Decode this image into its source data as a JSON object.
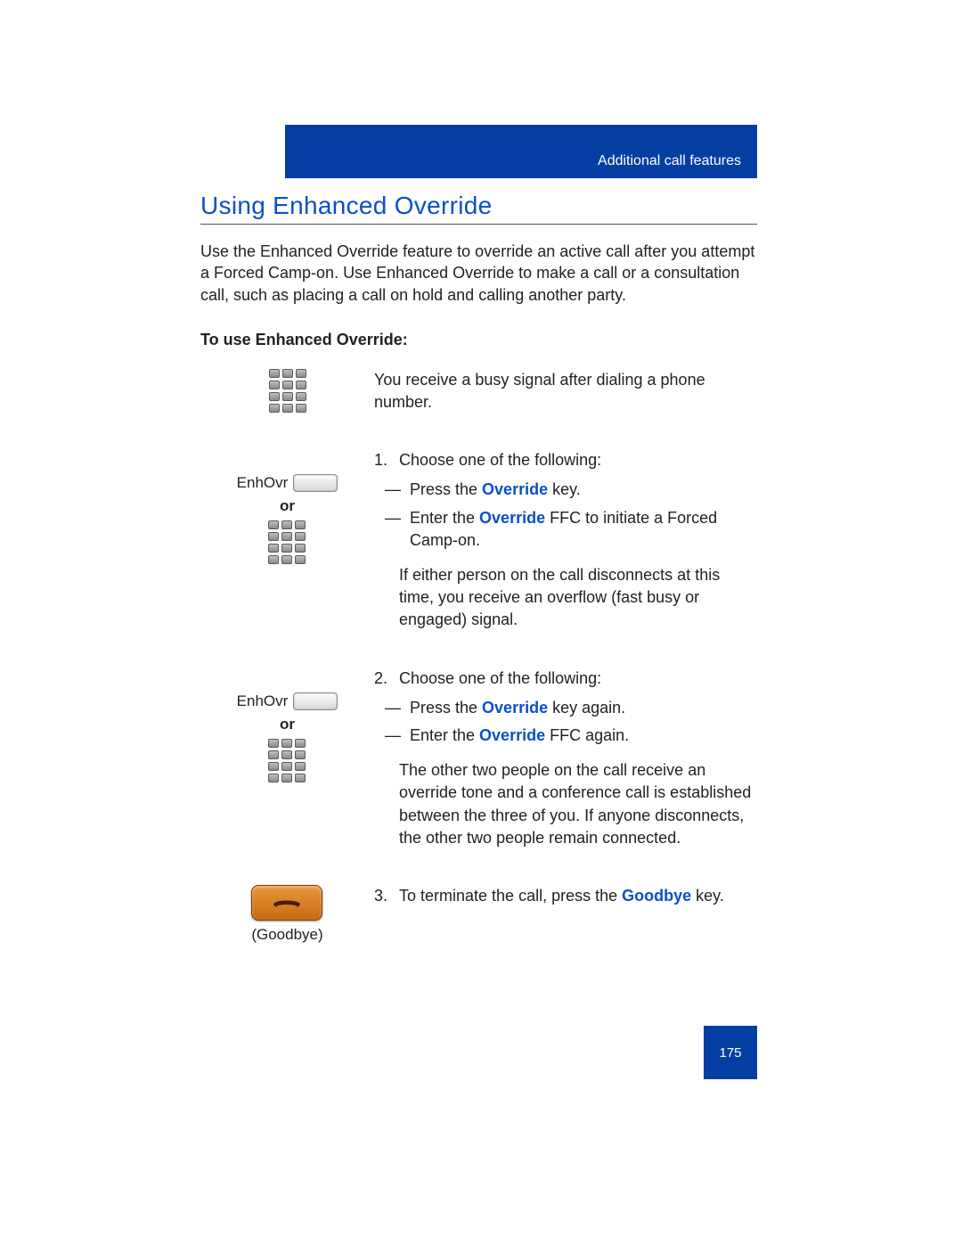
{
  "header": {
    "category": "Additional call features"
  },
  "title": "Using Enhanced Override",
  "intro": "Use the Enhanced Override feature to override an active call after you attempt a Forced Camp-on. Use Enhanced Override to make a call or a consultation call, such as placing a call on hold and calling another party.",
  "subhead": "To use Enhanced Override:",
  "labels": {
    "enhovr": "EnhOvr",
    "or": "or",
    "goodbye": "(Goodbye)"
  },
  "step0": "You receive a busy signal after dialing a phone number.",
  "step1": {
    "num": "1.",
    "lead": "Choose one of the following:",
    "a_pre": "Press the ",
    "a_key": "Override",
    "a_post": " key.",
    "b_pre": "Enter the ",
    "b_key": "Override",
    "b_post": " FFC to initiate a Forced Camp-on.",
    "note": "If either person on the call disconnects at this time, you receive an overflow (fast busy or engaged) signal."
  },
  "step2": {
    "num": "2.",
    "lead": "Choose one of the following:",
    "a_pre": "Press the ",
    "a_key": "Override",
    "a_post": " key again.",
    "b_pre": "Enter the ",
    "b_key": "Override",
    "b_post": " FFC again.",
    "note": "The other two people on the call receive an override tone and a conference call is established between the three of you. If anyone disconnects, the other two people remain connected."
  },
  "step3": {
    "num": "3.",
    "pre": "To terminate the call, press the ",
    "key": "Goodbye",
    "post": " key."
  },
  "page_number": "175"
}
